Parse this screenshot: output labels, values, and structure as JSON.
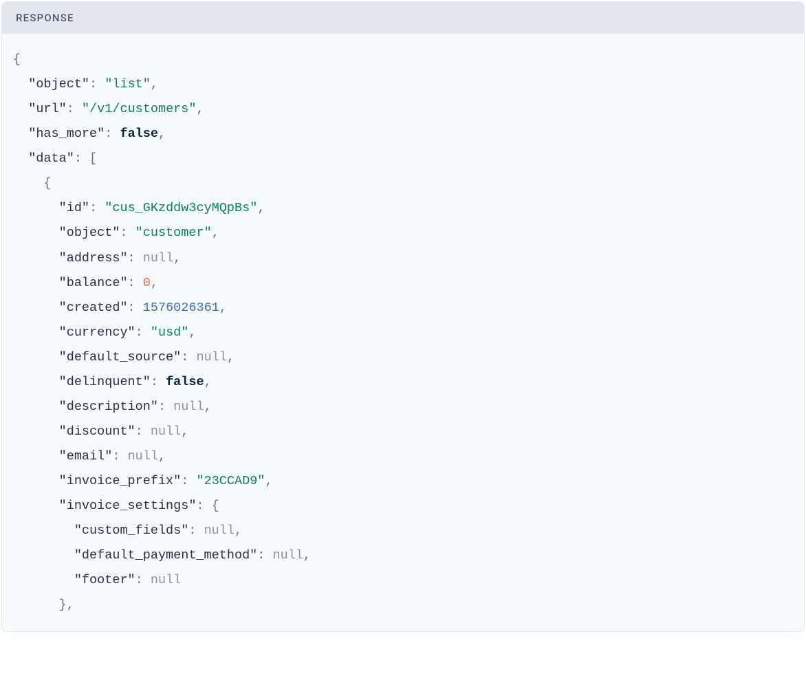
{
  "header": {
    "title": "RESPONSE"
  },
  "json": {
    "object_key": "\"object\"",
    "object_val": "\"list\"",
    "url_key": "\"url\"",
    "url_val": "\"/v1/customers\"",
    "has_more_key": "\"has_more\"",
    "has_more_val": "false",
    "data_key": "\"data\"",
    "id_key": "\"id\"",
    "id_val": "\"cus_GKzddw3cyMQpBs\"",
    "object2_key": "\"object\"",
    "object2_val": "\"customer\"",
    "address_key": "\"address\"",
    "address_val": "null",
    "balance_key": "\"balance\"",
    "balance_val": "0",
    "created_key": "\"created\"",
    "created_val": "1576026361",
    "currency_key": "\"currency\"",
    "currency_val": "\"usd\"",
    "default_source_key": "\"default_source\"",
    "default_source_val": "null",
    "delinquent_key": "\"delinquent\"",
    "delinquent_val": "false",
    "description_key": "\"description\"",
    "description_val": "null",
    "discount_key": "\"discount\"",
    "discount_val": "null",
    "email_key": "\"email\"",
    "email_val": "null",
    "invoice_prefix_key": "\"invoice_prefix\"",
    "invoice_prefix_val": "\"23CCAD9\"",
    "invoice_settings_key": "\"invoice_settings\"",
    "custom_fields_key": "\"custom_fields\"",
    "custom_fields_val": "null",
    "default_payment_method_key": "\"default_payment_method\"",
    "default_payment_method_val": "null",
    "footer_key": "\"footer\"",
    "footer_val": "null"
  }
}
